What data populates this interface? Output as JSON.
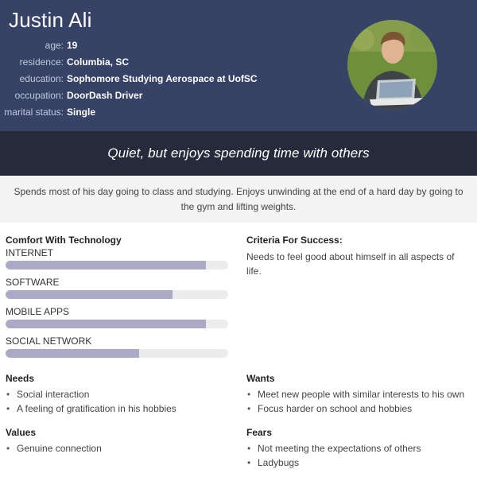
{
  "persona": {
    "name": "Justin Ali",
    "facts": [
      {
        "label": "age:",
        "value": "19"
      },
      {
        "label": "residence:",
        "value": "Columbia, SC"
      },
      {
        "label": "education:",
        "value": "Sophomore Studying Aerospace at UofSC"
      },
      {
        "label": "occupation:",
        "value": "DoorDash Driver"
      },
      {
        "label": "marital status:",
        "value": "Single"
      }
    ],
    "quote": "Quiet, but enjoys spending time with others",
    "summary": "Spends most of his day going to class and studying. Enjoys unwinding at the end of a hard day by going to the gym and lifting weights."
  },
  "technology": {
    "title": "Comfort With Technology",
    "items": [
      {
        "label": "INTERNET",
        "level": 0.9
      },
      {
        "label": "SOFTWARE",
        "level": 0.75
      },
      {
        "label": "MOBILE APPS",
        "level": 0.9
      },
      {
        "label": "SOCIAL NETWORK",
        "level": 0.6
      }
    ]
  },
  "criteria": {
    "title": "Criteria For Success:",
    "text": "Needs to feel good about himself in all aspects of life."
  },
  "needs": {
    "title": "Needs",
    "items": [
      "Social interaction",
      "A feeling of gratification in his hobbies"
    ]
  },
  "wants": {
    "title": "Wants",
    "items": [
      "Meet new people with similar interests to his own",
      "Focus harder on school and hobbies"
    ]
  },
  "values": {
    "title": "Values",
    "items": [
      "Genuine connection"
    ]
  },
  "fears": {
    "title": "Fears",
    "items": [
      "Not meeting the expectations of others",
      "Ladybugs"
    ]
  },
  "colors": {
    "header_bg": "#364266",
    "quote_bg": "#252b3a",
    "bar_fill": "#aba9c6",
    "bar_track": "#ececec"
  }
}
